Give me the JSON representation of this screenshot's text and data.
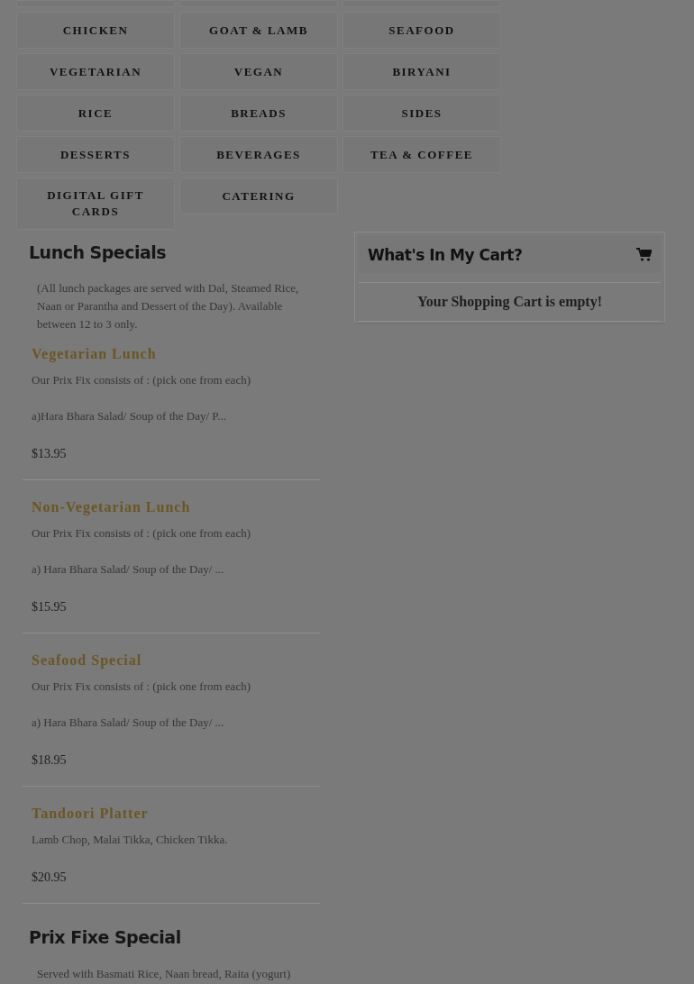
{
  "categories": [
    "CHICKEN",
    "GOAT & LAMB",
    "SEAFOOD",
    "VEGETARIAN",
    "VEGAN",
    "BIRYANI",
    "RICE",
    "BREADS",
    "SIDES",
    "DESSERTS",
    "BEVERAGES",
    "TEA & COFFEE",
    "DIGITAL GIFT CARDS",
    "CATERING"
  ],
  "lunch": {
    "title": "Lunch Specials",
    "note": "(All lunch packages are served with Dal, Steamed Rice, Naan or Parantha and Dessert of the Day). Available between 12 to 3 only.",
    "items": [
      {
        "name": "Vegetarian Lunch",
        "lines": [
          "Our Prix Fix consists of : (pick one from each)",
          "a)Hara Bhara Salad/ Soup of the Day/ P..."
        ],
        "price": "$13.95"
      },
      {
        "name": "Non-Vegetarian Lunch",
        "lines": [
          "Our Prix Fix consists of : (pick one from each)",
          "a) Hara Bhara Salad/ Soup of the Day/ ..."
        ],
        "price": "$15.95"
      },
      {
        "name": "Seafood Special",
        "lines": [
          "Our Prix Fix consists of : (pick one from each)",
          "a) Hara Bhara Salad/ Soup of the Day/ ..."
        ],
        "price": "$18.95"
      },
      {
        "name": "Tandoori Platter",
        "lines": [
          "Lamb Chop, Malai Tikka, Chicken Tikka."
        ],
        "price": "$20.95"
      }
    ]
  },
  "prix_fixe": {
    "title": "Prix Fixe Special",
    "note": "Served with Basmati Rice, Naan bread, Raita (yogurt)"
  },
  "cart": {
    "title": "What's In My Cart?",
    "message": "Your Shopping Cart is empty!"
  }
}
